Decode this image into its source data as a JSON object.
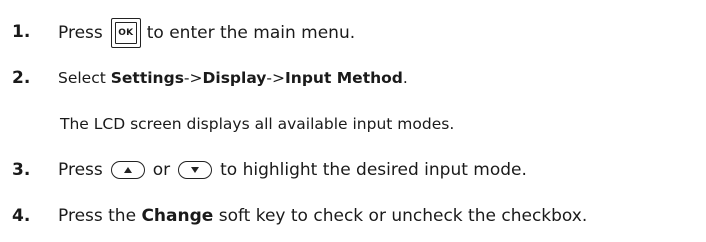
{
  "steps": [
    {
      "number": "1.",
      "before": "Press",
      "key": "OK",
      "after": "to enter the main menu."
    },
    {
      "number": "2.",
      "select": "Select ",
      "path1": "Settings",
      "arrow1": "->",
      "path2": "Display",
      "arrow2": "->",
      "path3": "Input Method",
      "period": "."
    },
    {
      "note": "The LCD screen displays all available input modes."
    },
    {
      "number": "3.",
      "before": "Press",
      "or": "or",
      "after": "to highlight the desired input mode."
    },
    {
      "number": "4.",
      "before": "Press the ",
      "bold": "Change",
      "after": " soft key to check or uncheck the checkbox."
    }
  ],
  "icons": {
    "ok_key": "ok-key-icon",
    "up_key": "up-arrow-key-icon",
    "down_key": "down-arrow-key-icon"
  }
}
